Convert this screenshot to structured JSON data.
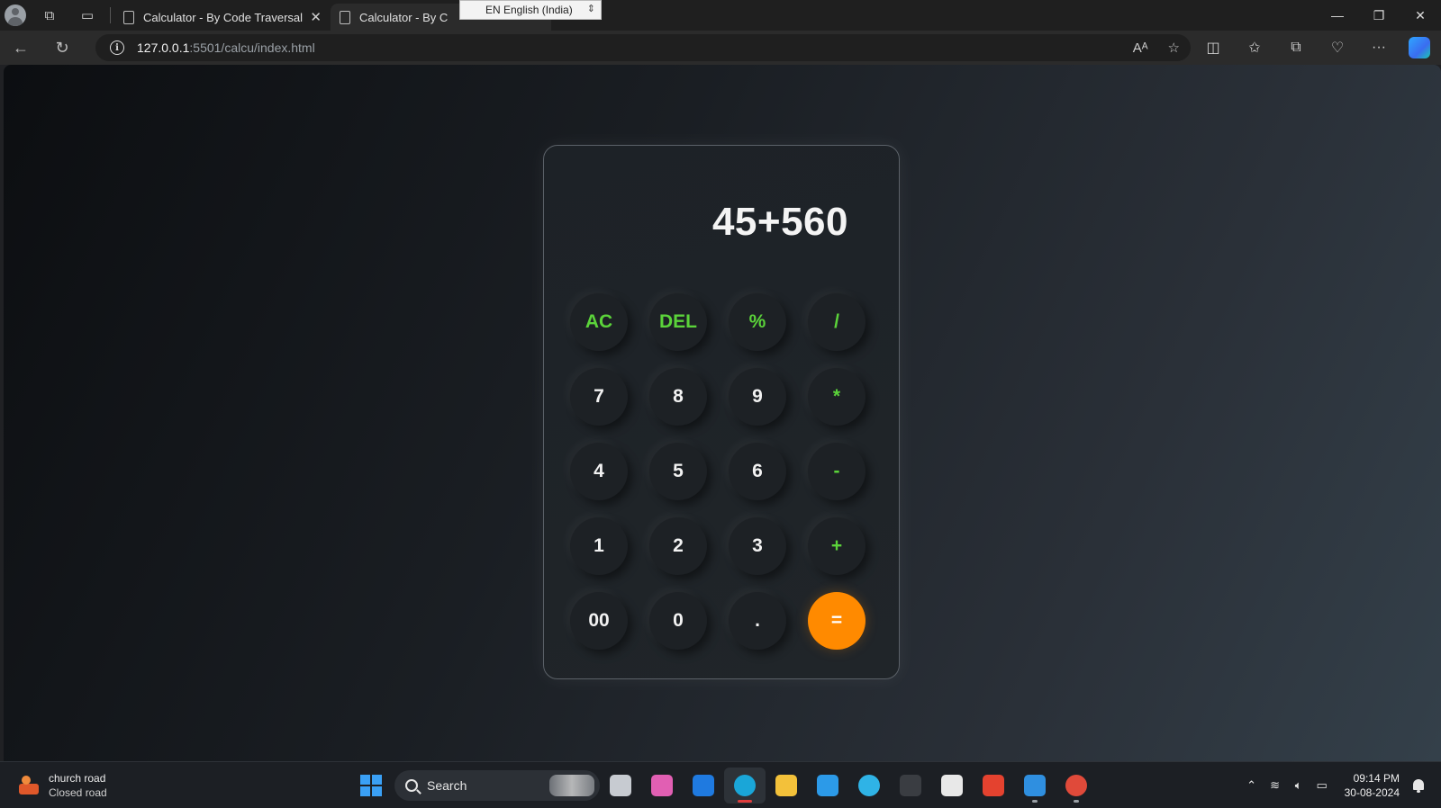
{
  "browser": {
    "tabs": [
      {
        "title": "Calculator - By Code Traversal",
        "close": "✕"
      },
      {
        "title": "Calculator - By C"
      }
    ],
    "language_tooltip": "EN English (India)",
    "url_host": "127.0.0.1",
    "url_rest": ":5501/calcu/index.html",
    "window_controls": {
      "minimize": "—",
      "restore": "❐",
      "close": "✕"
    }
  },
  "calculator": {
    "display": "45+560",
    "keys": [
      {
        "label": "AC",
        "kind": "op",
        "name": "all-clear"
      },
      {
        "label": "DEL",
        "kind": "op",
        "name": "delete"
      },
      {
        "label": "%",
        "kind": "op",
        "name": "percent"
      },
      {
        "label": "/",
        "kind": "op",
        "name": "divide"
      },
      {
        "label": "7",
        "kind": "num",
        "name": "7"
      },
      {
        "label": "8",
        "kind": "num",
        "name": "8"
      },
      {
        "label": "9",
        "kind": "num",
        "name": "9"
      },
      {
        "label": "*",
        "kind": "op",
        "name": "multiply"
      },
      {
        "label": "4",
        "kind": "num",
        "name": "4"
      },
      {
        "label": "5",
        "kind": "num",
        "name": "5"
      },
      {
        "label": "6",
        "kind": "num",
        "name": "6"
      },
      {
        "label": "-",
        "kind": "op",
        "name": "subtract"
      },
      {
        "label": "1",
        "kind": "num",
        "name": "1"
      },
      {
        "label": "2",
        "kind": "num",
        "name": "2"
      },
      {
        "label": "3",
        "kind": "num",
        "name": "3"
      },
      {
        "label": "+",
        "kind": "op",
        "name": "add"
      },
      {
        "label": "00",
        "kind": "num",
        "name": "double-zero"
      },
      {
        "label": "0",
        "kind": "num",
        "name": "0"
      },
      {
        "label": ".",
        "kind": "num",
        "name": "decimal"
      },
      {
        "label": "=",
        "kind": "equal",
        "name": "equals"
      }
    ],
    "colors": {
      "operator": "#5bd33a",
      "equals": "#ff8a00"
    }
  },
  "taskbar": {
    "weather_title": "church road",
    "weather_sub": "Closed road",
    "search_label": "Search",
    "apps": [
      {
        "name": "task-view-app",
        "color": "#c7cbd1"
      },
      {
        "name": "copilot-app",
        "color": "#e15fb3"
      },
      {
        "name": "outlook-app",
        "color": "#1f7ae0"
      },
      {
        "name": "edge-app",
        "color": "#1aa6d8",
        "active": true
      },
      {
        "name": "file-explorer-app",
        "color": "#f3c13a"
      },
      {
        "name": "l-app",
        "color": "#2c9ae8"
      },
      {
        "name": "cortana-app",
        "color": "#2fb3e6"
      },
      {
        "name": "terminal-app",
        "color": "#3a3d42"
      },
      {
        "name": "word-app",
        "color": "#e8e8e8"
      },
      {
        "name": "recorder-app",
        "color": "#e4422f"
      },
      {
        "name": "vscode-app",
        "color": "#2f8fe0"
      },
      {
        "name": "chrome-app",
        "color": "#e04a3a"
      }
    ],
    "time": "09:14 PM",
    "date": "30-08-2024"
  }
}
